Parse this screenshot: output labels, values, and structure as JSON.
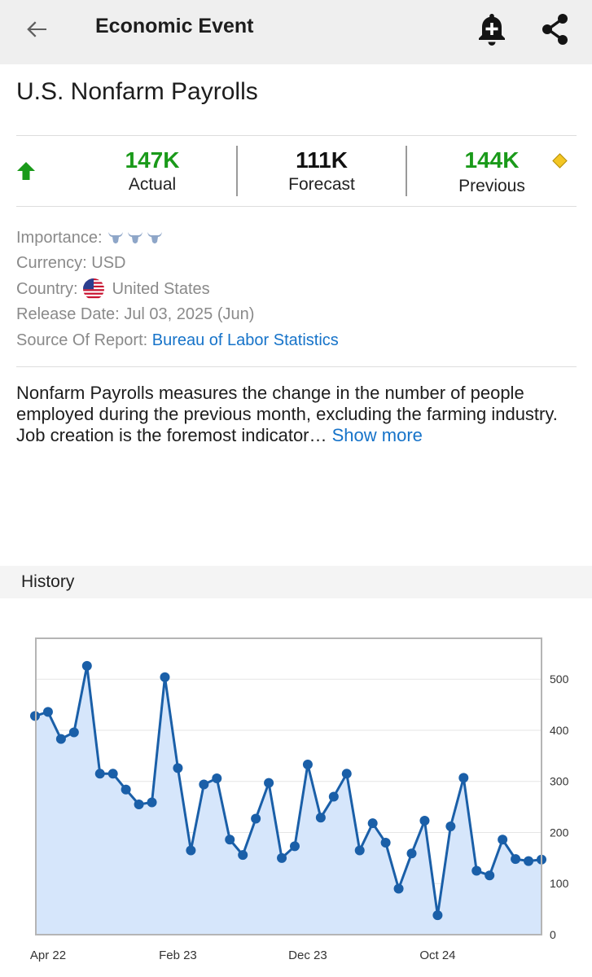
{
  "appbar": {
    "title": "Economic Event",
    "back_icon": "arrow-left-icon",
    "bell_icon": "bell-plus-icon",
    "share_icon": "share-icon"
  },
  "event": {
    "title": "U.S. Nonfarm Payrolls"
  },
  "metrics": {
    "trend_icon": "arrow-up-icon",
    "actual": {
      "value": "147K",
      "label": "Actual",
      "color": "#1a9a1a"
    },
    "forecast": {
      "value": "111K",
      "label": "Forecast",
      "color": "#111111"
    },
    "previous": {
      "value": "144K",
      "label": "Previous",
      "color": "#1a9a1a"
    },
    "revised_marker_icon": "diamond-icon"
  },
  "details": {
    "importance_label": "Importance:",
    "importance_level": 3,
    "currency_label": "Currency:",
    "currency": "USD",
    "country_label": "Country:",
    "country": "United States",
    "release_label": "Release Date:",
    "release_date": "Jul 03, 2025 (Jun)",
    "source_label": "Source Of Report:",
    "source": "Bureau of Labor Statistics"
  },
  "description": {
    "text": "Nonfarm Payrolls measures the change in the number of people employed during the previous month, excluding the farming industry. Job creation is the foremost indicator… ",
    "more": "Show more"
  },
  "history": {
    "title": "History"
  },
  "chart_data": {
    "type": "area",
    "x_ticks": [
      "Apr 22",
      "Feb 23",
      "Dec 23",
      "Oct 24"
    ],
    "x_tick_indices": [
      1,
      11,
      21,
      31
    ],
    "y_ticks": [
      0,
      100,
      200,
      300,
      400,
      500
    ],
    "ylim": [
      0,
      580
    ],
    "grid": true,
    "series": [
      {
        "values": [
          428,
          436,
          383,
          396,
          526,
          315,
          315,
          284,
          255,
          259,
          504,
          326,
          165,
          294,
          306,
          186,
          156,
          227,
          297,
          150,
          173,
          333,
          229,
          270,
          315,
          165,
          218,
          180,
          90,
          159,
          223,
          38,
          212,
          307,
          125,
          116,
          186,
          148,
          144,
          147
        ],
        "color": "#1a5fa8",
        "fill": "#d6e6fb"
      }
    ]
  }
}
